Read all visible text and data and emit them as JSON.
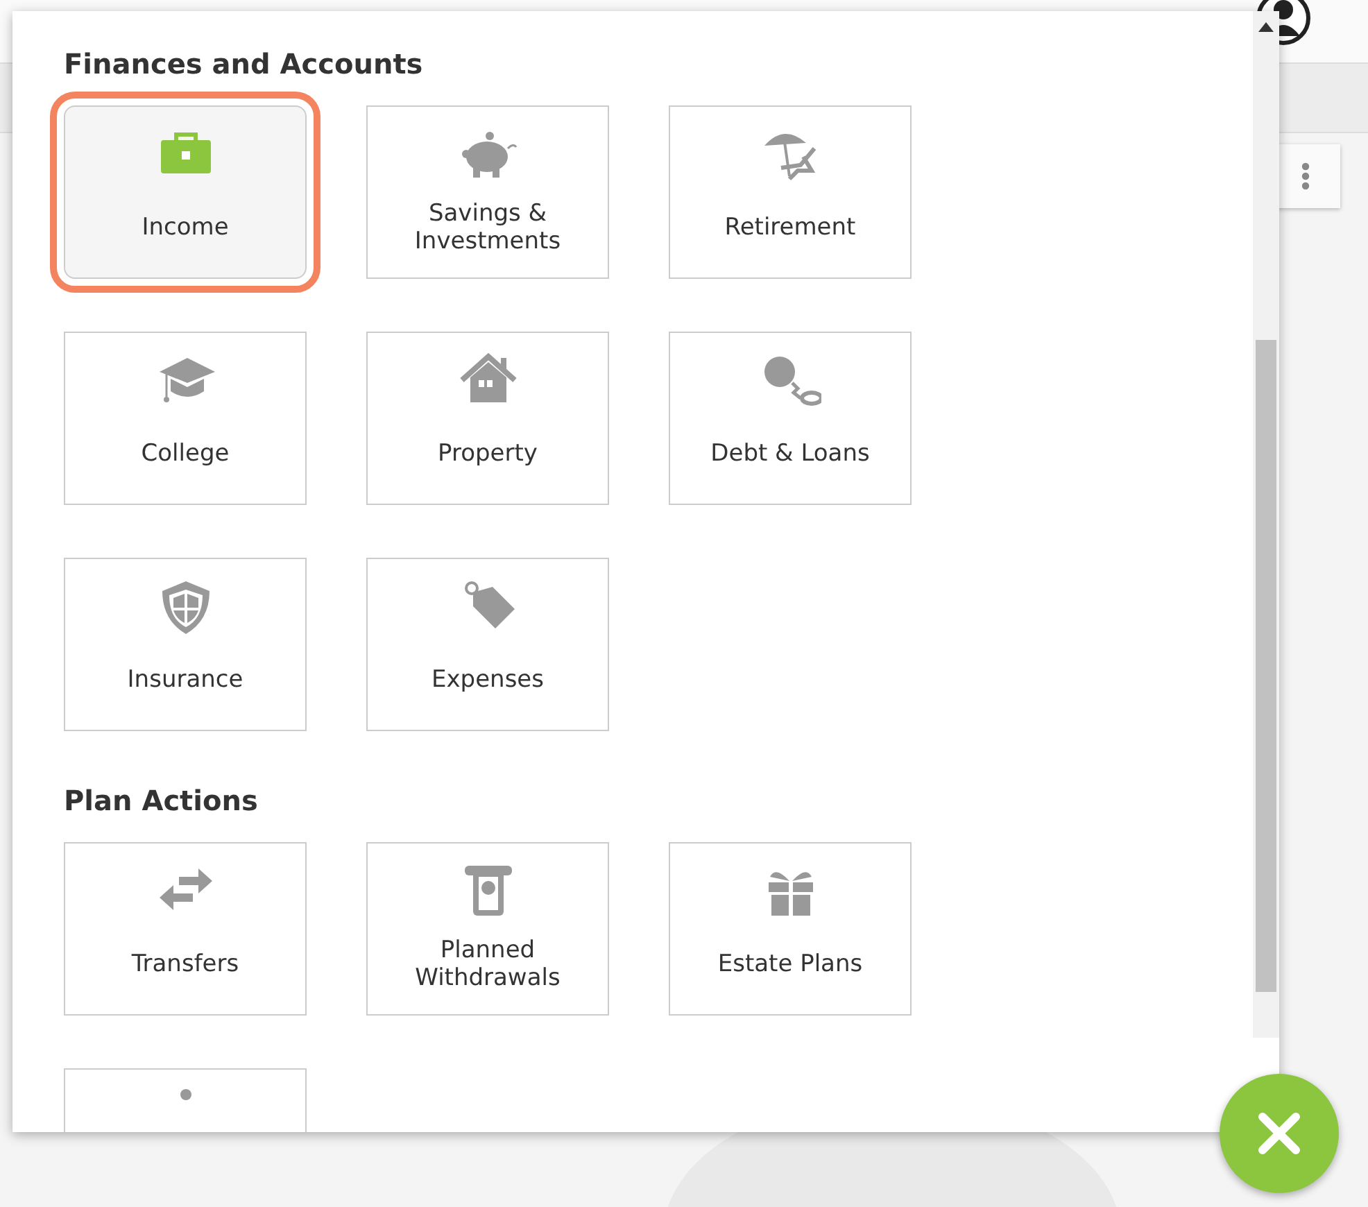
{
  "sections": [
    {
      "title": "Finances and Accounts",
      "items": [
        {
          "label": "Income",
          "kind": "briefcase",
          "selected": true
        },
        {
          "label": "Savings & Investments",
          "kind": "piggy",
          "selected": false
        },
        {
          "label": "Retirement",
          "kind": "beach",
          "selected": false
        },
        {
          "label": "College",
          "kind": "cap",
          "selected": false
        },
        {
          "label": "Property",
          "kind": "house",
          "selected": false
        },
        {
          "label": "Debt & Loans",
          "kind": "ball",
          "selected": false
        },
        {
          "label": "Insurance",
          "kind": "shield",
          "selected": false
        },
        {
          "label": "Expenses",
          "kind": "tag",
          "selected": false
        }
      ]
    },
    {
      "title": "Plan Actions",
      "items": [
        {
          "label": "Transfers",
          "kind": "arrows",
          "selected": false
        },
        {
          "label": "Planned Withdrawals",
          "kind": "atm",
          "selected": false
        },
        {
          "label": "Estate Plans",
          "kind": "gift",
          "selected": false
        },
        {
          "kind": "dot",
          "selected": false
        }
      ]
    }
  ]
}
